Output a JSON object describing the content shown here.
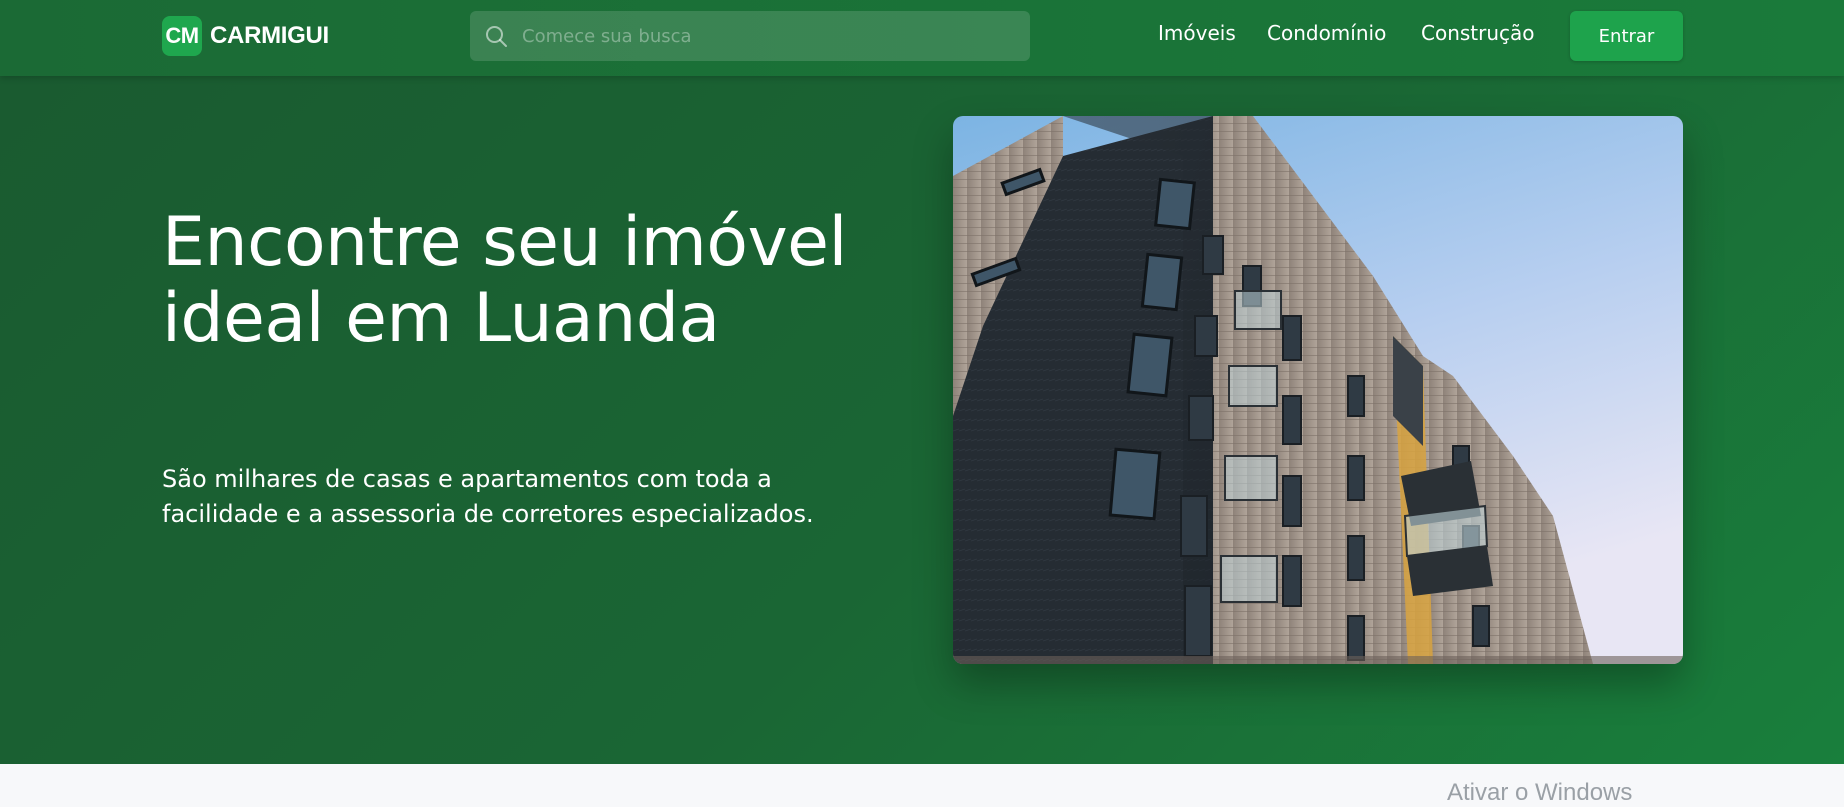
{
  "brand": {
    "mark": "CM",
    "name": "CARMIGUI",
    "mark_color": "#1fa74e"
  },
  "search": {
    "placeholder": "Comece sua busca",
    "icon": "search-icon"
  },
  "nav": {
    "items": [
      {
        "label": "Imóveis"
      },
      {
        "label": "Condomínio"
      },
      {
        "label": "Construção"
      }
    ],
    "login_label": "Entrar",
    "login_color": "#1ea34c"
  },
  "hero": {
    "title": "Encontre seu imóvel ideal em Luanda",
    "subtitle": "São milhares de casas e apartamentos com toda a facilidade e a assessoria de corretores especializados.",
    "image": "apartment-building-photo",
    "background_color": "#1a6634"
  },
  "os_watermark": "Ativar o Windows"
}
